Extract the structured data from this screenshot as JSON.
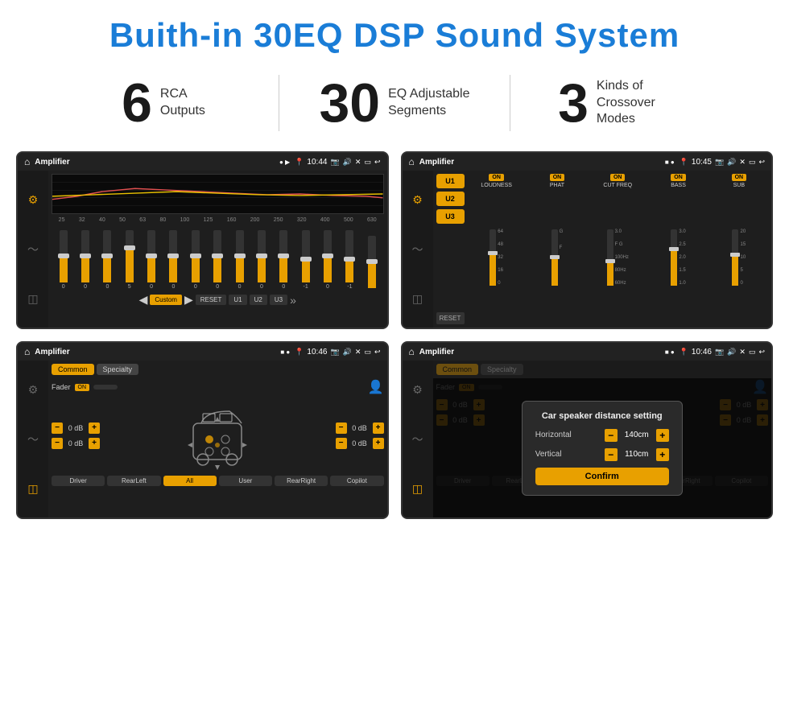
{
  "header": {
    "title": "Buith-in 30EQ DSP Sound System"
  },
  "stats": [
    {
      "number": "6",
      "label": "RCA\nOutputs"
    },
    {
      "number": "30",
      "label": "EQ Adjustable\nSegments"
    },
    {
      "number": "3",
      "label": "Kinds of\nCrossover Modes"
    }
  ],
  "screens": [
    {
      "id": "eq-screen",
      "statusBar": {
        "appName": "Amplifier",
        "time": "10:44"
      }
    },
    {
      "id": "crossover-screen",
      "statusBar": {
        "appName": "Amplifier",
        "time": "10:45"
      }
    },
    {
      "id": "speaker-screen",
      "statusBar": {
        "appName": "Amplifier",
        "time": "10:46"
      }
    },
    {
      "id": "distance-screen",
      "statusBar": {
        "appName": "Amplifier",
        "time": "10:46"
      },
      "dialog": {
        "title": "Car speaker distance setting",
        "horizontal_label": "Horizontal",
        "horizontal_value": "140cm",
        "vertical_label": "Vertical",
        "vertical_value": "110cm",
        "confirm_label": "Confirm"
      }
    }
  ],
  "eq": {
    "bands": [
      "25",
      "32",
      "40",
      "50",
      "63",
      "80",
      "100",
      "125",
      "160",
      "200",
      "250",
      "320",
      "400",
      "500",
      "630"
    ],
    "values": [
      "0",
      "0",
      "0",
      "5",
      "0",
      "0",
      "0",
      "0",
      "0",
      "0",
      "0",
      "-1",
      "0",
      "-1",
      ""
    ],
    "presets": [
      "Custom",
      "RESET",
      "U1",
      "U2",
      "U3"
    ]
  },
  "crossover": {
    "users": [
      "U1",
      "U2",
      "U3"
    ],
    "channels": [
      "LOUDNESS",
      "PHAT",
      "CUT FREQ",
      "BASS",
      "SUB"
    ],
    "reset_label": "RESET"
  },
  "speaker": {
    "tabs": [
      "Common",
      "Specialty"
    ],
    "fader_label": "Fader",
    "db_rows": [
      {
        "value": "0 dB"
      },
      {
        "value": "0 dB"
      },
      {
        "value": "0 dB"
      },
      {
        "value": "0 dB"
      }
    ],
    "buttons": [
      "Driver",
      "RearLeft",
      "All",
      "User",
      "RearRight",
      "Copilot"
    ]
  }
}
